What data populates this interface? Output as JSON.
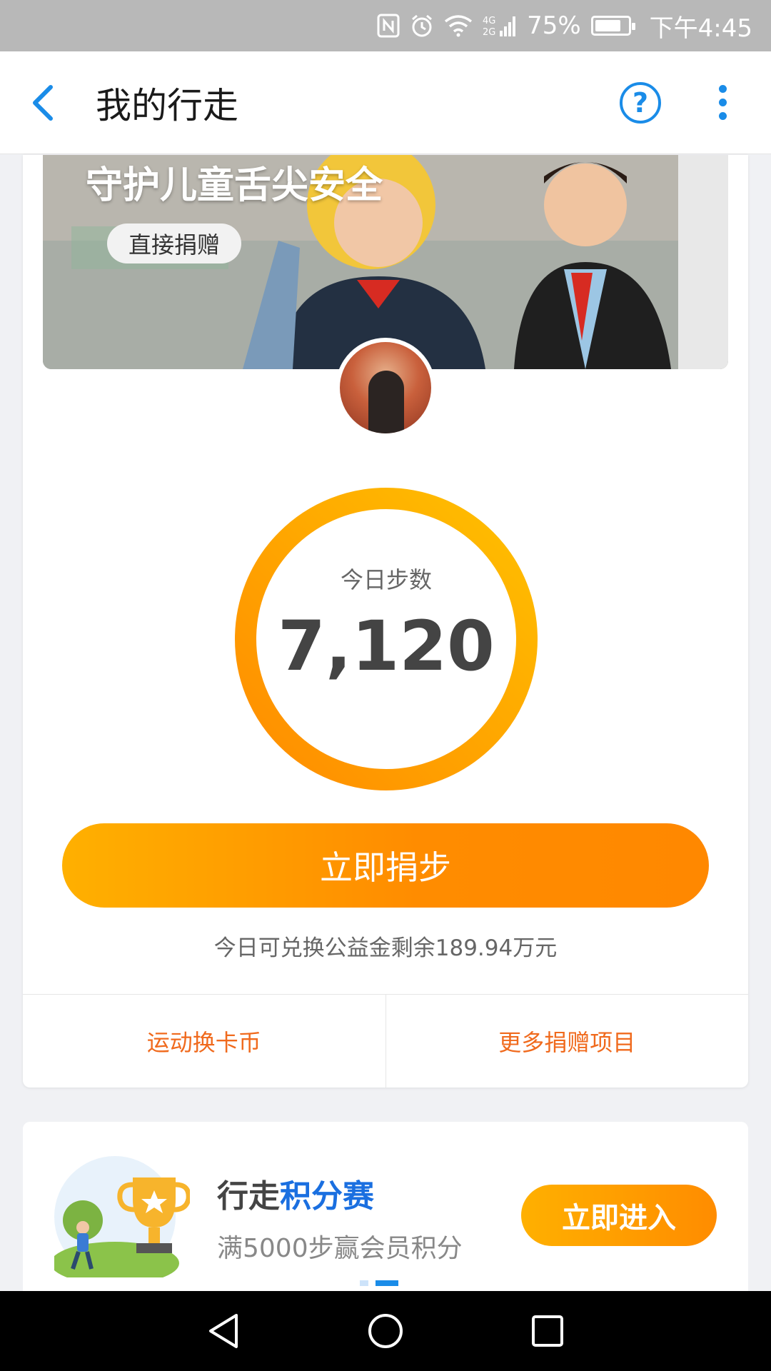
{
  "status_bar": {
    "battery": "75%",
    "time": "下午4:45",
    "network": "4G 2G"
  },
  "header": {
    "title": "我的行走",
    "help_icon": "question-circle-icon",
    "more_icon": "more-vertical-icon",
    "back_icon": "chevron-left-icon"
  },
  "banner": {
    "title": "守护儿童舌尖安全",
    "donate_label": "直接捐赠"
  },
  "steps": {
    "label": "今日步数",
    "value": "7,120"
  },
  "actions": {
    "donate_steps": "立即捐步",
    "remaining_note": "今日可兑换公益金剩余189.94万元",
    "link_left": "运动换卡币",
    "link_right": "更多捐赠项目"
  },
  "promo": {
    "title_prefix": "行走",
    "title_highlight": "积分赛",
    "subtitle": "满5000步赢会员积分",
    "button": "立即进入"
  },
  "colors": {
    "accent_blue": "#1a8ce8",
    "orange": "#ff8c00",
    "orange_light": "#ffb000",
    "link_orange": "#f06a1d"
  }
}
